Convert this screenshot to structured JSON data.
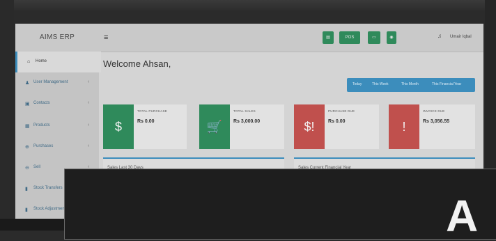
{
  "app": {
    "brand": "AIMS ERP",
    "menu_icon": "≡",
    "user": "Umair Iqbal"
  },
  "toolbar": {
    "buttons": [
      {
        "label": "▤",
        "icon": "calculator-icon"
      },
      {
        "label": "POS",
        "icon": "pos-icon"
      },
      {
        "label": "▭",
        "icon": "money-icon"
      },
      {
        "label": "◉",
        "icon": "location-icon"
      }
    ]
  },
  "sidebar": {
    "items": [
      {
        "label": "Home",
        "icon": "⌂"
      },
      {
        "label": "User Management",
        "icon": "♟"
      },
      {
        "label": "Contacts",
        "icon": "▣"
      },
      {
        "label": "Products",
        "icon": "▦"
      },
      {
        "label": "Purchases",
        "icon": "⊕"
      },
      {
        "label": "Sell",
        "icon": "⊖"
      },
      {
        "label": "Stock Transfers",
        "icon": "▮"
      },
      {
        "label": "Stock Adjustment",
        "icon": "▮"
      }
    ]
  },
  "main": {
    "welcome": "Welcome Ahsan,",
    "date_filters": [
      "Today",
      "This Week",
      "This Month",
      "This Financial Year"
    ],
    "cards": [
      {
        "title": "TOTAL PURCHASE",
        "value": "Rs 0.00",
        "icon": "$",
        "color": "#2f8a5b"
      },
      {
        "title": "TOTAL SALES",
        "value": "Rs 3,000.00",
        "icon": "🛒",
        "color": "#2f8a5b"
      },
      {
        "title": "PURCHASE DUE",
        "value": "Rs 0.00",
        "icon": "$!",
        "color": "#c0504d"
      },
      {
        "title": "INVOICE DUE",
        "value": "Rs 3,056.55",
        "icon": "!",
        "color": "#c0504d"
      }
    ],
    "panels": [
      {
        "title": "Sales Last 30 Days"
      },
      {
        "title": "Sales Current Financial Year"
      }
    ]
  },
  "overlay": {
    "letter": "A"
  }
}
